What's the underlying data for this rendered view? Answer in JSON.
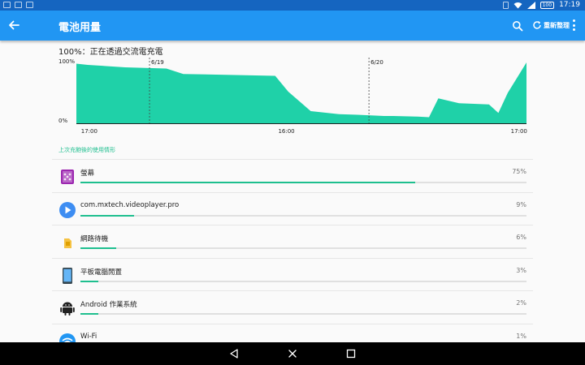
{
  "status_bar": {
    "battery": "100",
    "time": "17:19"
  },
  "app_bar": {
    "title": "電池用量",
    "refresh_label": "重新整理"
  },
  "charge_status": "100%：正在透過交流電充電",
  "chart_data": {
    "type": "area",
    "title": "",
    "y_tick_labels": [
      "100%",
      "0%"
    ],
    "x_tick_labels": [
      "17:00",
      "16:00",
      "17:00"
    ],
    "date_markers": [
      "6/19",
      "6/20"
    ],
    "ylim": [
      0,
      100
    ],
    "xlim": [
      0,
      24
    ],
    "x": [
      0,
      0.6,
      2.6,
      4.8,
      5.7,
      10.6,
      11.3,
      12.5,
      14.0,
      15.0,
      16.4,
      16.9,
      18.2,
      18.8,
      19.3,
      20.4,
      22.0,
      22.5,
      23.0,
      24.0
    ],
    "y": [
      98,
      96,
      92,
      90,
      81,
      78,
      52,
      20,
      15,
      14,
      12,
      12,
      11,
      10,
      41,
      33,
      31,
      17,
      50,
      100
    ],
    "color": "#1fd1a8"
  },
  "section_header": "上次充飽後的使用情形",
  "usage": [
    {
      "name": "螢幕",
      "percent": "75%",
      "fraction": 0.75,
      "icon": "screen-icon"
    },
    {
      "name": "com.mxtech.videoplayer.pro",
      "percent": "9%",
      "fraction": 0.12,
      "icon": "play-icon"
    },
    {
      "name": "網路待機",
      "percent": "6%",
      "fraction": 0.08,
      "icon": "sim-card-icon"
    },
    {
      "name": "平板電腦閒置",
      "percent": "3%",
      "fraction": 0.04,
      "icon": "tablet-icon"
    },
    {
      "name": "Android 作業系統",
      "percent": "2%",
      "fraction": 0.04,
      "icon": "android-icon"
    },
    {
      "name": "Wi-Fi",
      "percent": "1%",
      "fraction": 0.02,
      "icon": "wifi-icon"
    }
  ],
  "colors": {
    "accent": "#1fbf8f",
    "primary": "#2196f3",
    "status_bar": "#1565c0"
  }
}
